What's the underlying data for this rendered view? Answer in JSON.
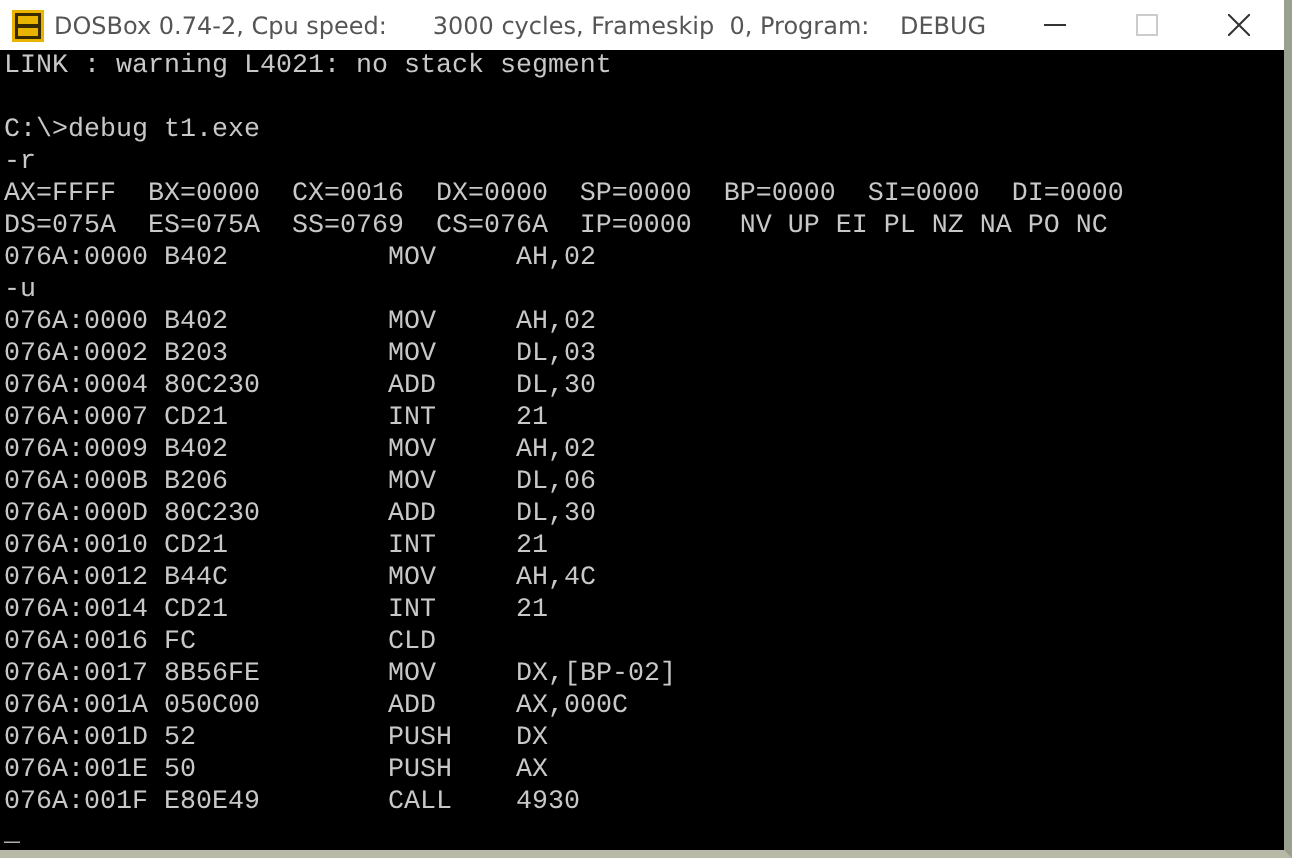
{
  "window": {
    "title": "DOSBox 0.74-2, Cpu speed:      3000 cycles, Frameskip  0, Program:    DEBUG"
  },
  "console": {
    "lines": [
      {
        "kind": "text",
        "text": "LINK : warning L4021: no stack segment"
      },
      {
        "kind": "blank"
      },
      {
        "kind": "text",
        "text": "C:\\>debug t1.exe"
      },
      {
        "kind": "text",
        "text": "-r"
      },
      {
        "kind": "text",
        "text": "AX=FFFF  BX=0000  CX=0016  DX=0000  SP=0000  BP=0000  SI=0000  DI=0000"
      },
      {
        "kind": "text",
        "text": "DS=075A  ES=075A  SS=0769  CS=076A  IP=0000   NV UP EI PL NZ NA PO NC"
      },
      {
        "kind": "disasm",
        "address": "076A:0000",
        "bytes": "B402",
        "mnemonic": "MOV",
        "operands": "AH,02"
      },
      {
        "kind": "text",
        "text": "-u"
      },
      {
        "kind": "disasm",
        "address": "076A:0000",
        "bytes": "B402",
        "mnemonic": "MOV",
        "operands": "AH,02"
      },
      {
        "kind": "disasm",
        "address": "076A:0002",
        "bytes": "B203",
        "mnemonic": "MOV",
        "operands": "DL,03"
      },
      {
        "kind": "disasm",
        "address": "076A:0004",
        "bytes": "80C230",
        "mnemonic": "ADD",
        "operands": "DL,30"
      },
      {
        "kind": "disasm",
        "address": "076A:0007",
        "bytes": "CD21",
        "mnemonic": "INT",
        "operands": "21"
      },
      {
        "kind": "disasm",
        "address": "076A:0009",
        "bytes": "B402",
        "mnemonic": "MOV",
        "operands": "AH,02"
      },
      {
        "kind": "disasm",
        "address": "076A:000B",
        "bytes": "B206",
        "mnemonic": "MOV",
        "operands": "DL,06"
      },
      {
        "kind": "disasm",
        "address": "076A:000D",
        "bytes": "80C230",
        "mnemonic": "ADD",
        "operands": "DL,30"
      },
      {
        "kind": "disasm",
        "address": "076A:0010",
        "bytes": "CD21",
        "mnemonic": "INT",
        "operands": "21"
      },
      {
        "kind": "disasm",
        "address": "076A:0012",
        "bytes": "B44C",
        "mnemonic": "MOV",
        "operands": "AH,4C"
      },
      {
        "kind": "disasm",
        "address": "076A:0014",
        "bytes": "CD21",
        "mnemonic": "INT",
        "operands": "21"
      },
      {
        "kind": "disasm",
        "address": "076A:0016",
        "bytes": "FC",
        "mnemonic": "CLD"
      },
      {
        "kind": "disasm",
        "address": "076A:0017",
        "bytes": "8B56FE",
        "mnemonic": "MOV",
        "operands": "DX,[BP-02]"
      },
      {
        "kind": "disasm",
        "address": "076A:001A",
        "bytes": "050C00",
        "mnemonic": "ADD",
        "operands": "AX,000C"
      },
      {
        "kind": "disasm",
        "address": "076A:001D",
        "bytes": "52",
        "mnemonic": "PUSH",
        "operands": "DX"
      },
      {
        "kind": "disasm",
        "address": "076A:001E",
        "bytes": "50",
        "mnemonic": "PUSH",
        "operands": "AX"
      },
      {
        "kind": "disasm",
        "address": "076A:001F",
        "bytes": "E80E49",
        "mnemonic": "CALL",
        "operands": "4930"
      },
      {
        "kind": "cursor",
        "text": "_"
      }
    ]
  }
}
